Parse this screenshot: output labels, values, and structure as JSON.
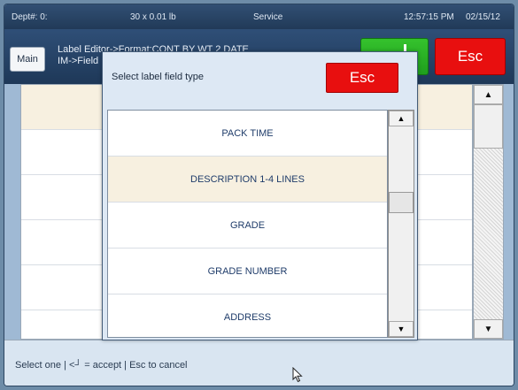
{
  "status": {
    "dept": "Dept#: 0:",
    "weight": "30 x 0.01 lb",
    "mode": "Service",
    "time": "12:57:15 PM",
    "date": "02/15/12"
  },
  "header": {
    "main_label": "Main",
    "breadcrumb_line1": "Label Editor->Format:CONT BY WT 2 DATE",
    "breadcrumb_line2": "IM->Field",
    "esc_label": "Esc"
  },
  "dialog": {
    "title": "Select label field type",
    "esc_label": "Esc",
    "items": [
      "PACK TIME",
      "DESCRIPTION 1-4 LINES",
      "GRADE",
      "GRADE NUMBER",
      "ADDRESS"
    ],
    "selected_index": 1
  },
  "footer": {
    "hint": "Select one | <┘ = accept | Esc to cancel"
  },
  "colors": {
    "esc": "#e80f0f",
    "enter": "#2cb92a",
    "selected_row": "#f7f0e0"
  }
}
